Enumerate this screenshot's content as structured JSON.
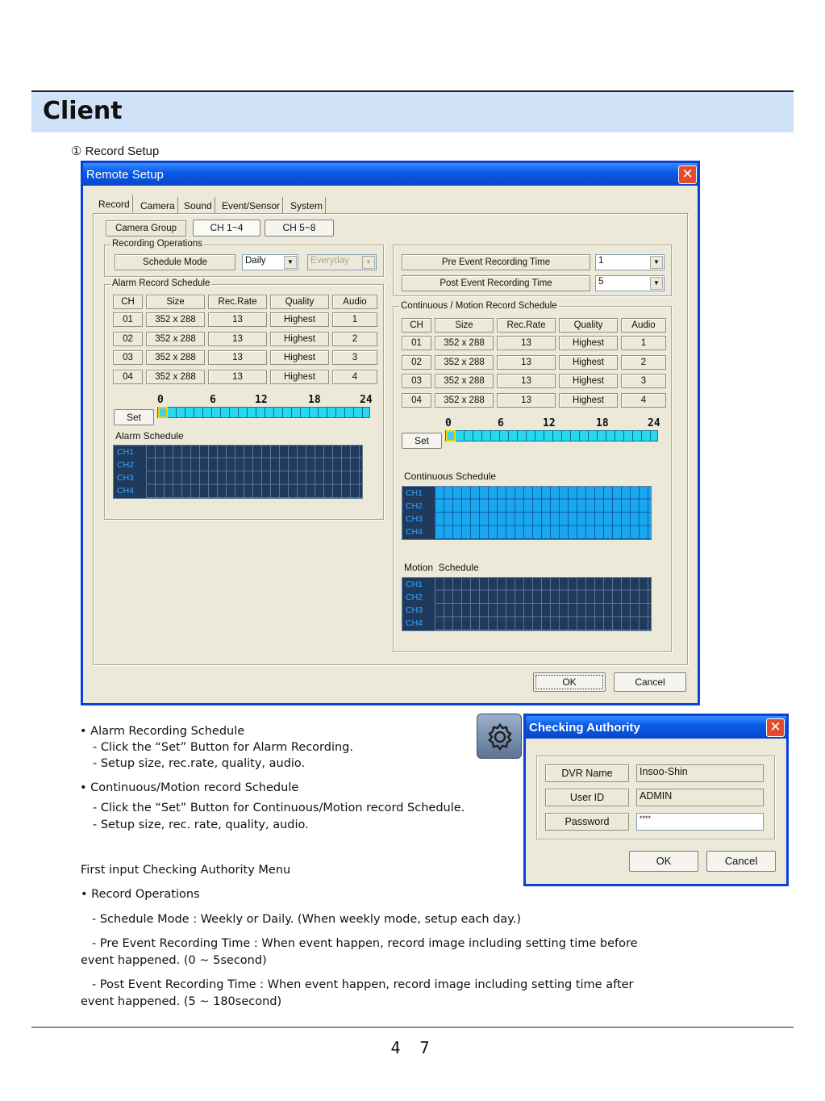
{
  "page": {
    "header_title": "Client",
    "section_title": "① Record Setup",
    "page_number": "4 7"
  },
  "remote_setup": {
    "title": "Remote Setup",
    "close_glyph": "✕",
    "tabs": [
      "Record",
      "Camera",
      "Sound",
      "Event/Sensor",
      "System"
    ],
    "camera_group_label": "Camera Group",
    "camera_group_buttons": [
      "CH 1~4",
      "CH 5~8"
    ],
    "recording_operations": {
      "group_label": "Recording Operations",
      "schedule_mode_label": "Schedule Mode",
      "schedule_mode_value": "Daily",
      "day_value": "Everyday"
    },
    "pre_event": {
      "label": "Pre Event Recording Time",
      "value": "1"
    },
    "post_event": {
      "label": "Post Event Recording Time",
      "value": "5"
    },
    "alarm": {
      "group_label": "Alarm Record Schedule",
      "columns": [
        "CH",
        "Size",
        "Rec.Rate",
        "Quality",
        "Audio"
      ],
      "rows": [
        [
          "01",
          "352 x 288",
          "13",
          "Highest",
          "1"
        ],
        [
          "02",
          "352 x 288",
          "13",
          "Highest",
          "2"
        ],
        [
          "03",
          "352 x 288",
          "13",
          "Highest",
          "3"
        ],
        [
          "04",
          "352 x 288",
          "13",
          "Highest",
          "4"
        ]
      ],
      "axis": [
        "0",
        "6",
        "12",
        "18",
        "24"
      ],
      "set_label": "Set",
      "schedule_label": "Alarm Schedule",
      "channels": [
        "CH1",
        "CH2",
        "CH3",
        "CH4"
      ]
    },
    "continuous": {
      "group_label": "Continuous / Motion Record Schedule",
      "columns": [
        "CH",
        "Size",
        "Rec.Rate",
        "Quality",
        "Audio"
      ],
      "rows": [
        [
          "01",
          "352 x 288",
          "13",
          "Highest",
          "1"
        ],
        [
          "02",
          "352 x 288",
          "13",
          "Highest",
          "2"
        ],
        [
          "03",
          "352 x 288",
          "13",
          "Highest",
          "3"
        ],
        [
          "04",
          "352 x 288",
          "13",
          "Highest",
          "4"
        ]
      ],
      "axis": [
        "0",
        "6",
        "12",
        "18",
        "24"
      ],
      "set_label": "Set",
      "continuous_label": "Continuous Schedule",
      "motion_label": "Motion  Schedule",
      "channels": [
        "CH1",
        "CH2",
        "CH3",
        "CH4"
      ]
    },
    "ok_label": "OK",
    "cancel_label": "Cancel"
  },
  "checking_authority": {
    "title": "Checking Authority",
    "close_glyph": "✕",
    "fields": [
      {
        "label": "DVR Name",
        "value": "Insoo-Shin"
      },
      {
        "label": "User ID",
        "value": "ADMIN"
      },
      {
        "label": "Password",
        "value": "****"
      }
    ],
    "ok_label": "OK",
    "cancel_label": "Cancel"
  },
  "notes": {
    "alarm_head": "• Alarm Recording Schedule",
    "alarm_1": "- Click the “Set” Button for Alarm Recording.",
    "alarm_2": "- Setup size, rec.rate, quality, audio.",
    "cont_head": "• Continuous/Motion record Schedule",
    "cont_1": "- Click the “Set” Button for Continuous/Motion record Schedule.",
    "cont_2": "- Setup size, rec. rate, quality, audio.",
    "first_input": "First input Checking Authority Menu",
    "ops_head": "• Record Operations",
    "ops_1": "- Schedule Mode : Weekly or Daily. (When weekly mode, setup each day.)",
    "ops_2a": "- Pre Event Recording Time : When event happen, record image including setting time before",
    "ops_2b": "event happened. (0 ~ 5second)",
    "ops_3a": "- Post Event Recording Time : When event happen, record image including setting time after",
    "ops_3b": "event happened. (5 ~ 180second)"
  }
}
